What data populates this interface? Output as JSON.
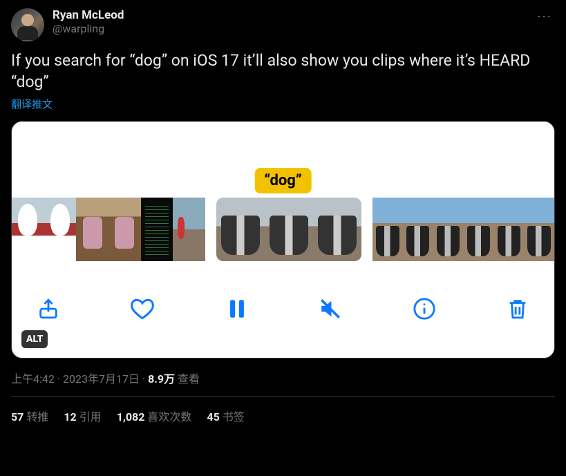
{
  "author": {
    "display_name": "Ryan McLeod",
    "handle": "@warpling"
  },
  "tweet_text": "If you search for “dog” on iOS 17 it’ll also show you clips where it’s HEARD “dog”",
  "translate_label": "翻译推文",
  "media": {
    "caption_bubble": "“dog”",
    "alt_badge": "ALT",
    "controls": {
      "share": "share",
      "like": "like",
      "pause": "pause",
      "mute": "mute",
      "info": "info",
      "delete": "delete"
    }
  },
  "meta": {
    "time": "上午4:42",
    "sep1": " · ",
    "date": "2023年7月17日",
    "sep2": " · ",
    "views_count": "8.9万",
    "views_label": " 查看"
  },
  "stats": {
    "retweets_n": "57",
    "retweets_label": "转推",
    "quotes_n": "12",
    "quotes_label": "引用",
    "likes_n": "1,082",
    "likes_label": "喜欢次数",
    "bookmarks_n": "45",
    "bookmarks_label": "书签"
  }
}
